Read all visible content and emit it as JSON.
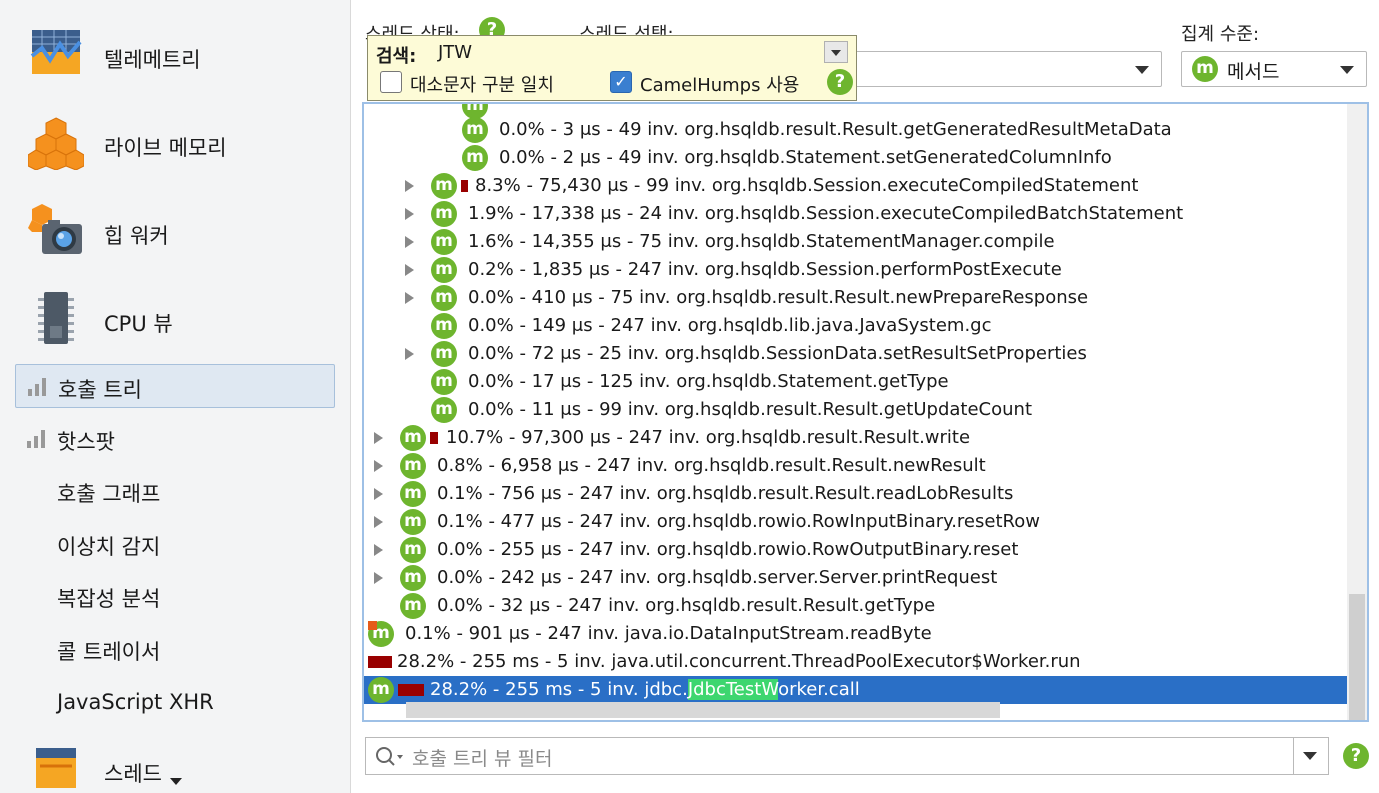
{
  "sidebar": {
    "big_items": [
      {
        "label": "텔레메트리",
        "icon": "telemetry-icon"
      },
      {
        "label": "라이브 메모리",
        "icon": "live-memory-icon"
      },
      {
        "label": "힙 워커",
        "icon": "heap-walker-icon"
      },
      {
        "label": "CPU 뷰",
        "icon": "cpu-chip-icon"
      }
    ],
    "small_items": [
      {
        "label": "호출 트리",
        "selected": true
      },
      {
        "label": "핫스팟"
      },
      {
        "label": "호출 그래프"
      },
      {
        "label": "이상치 감지"
      },
      {
        "label": "복잡성 분석"
      },
      {
        "label": "콜 트레이서"
      },
      {
        "label": "JavaScript XHR"
      }
    ],
    "bottom_item": {
      "label": "스레드",
      "icon": "threads-icon"
    }
  },
  "controls": {
    "thread_status_label": "스레드 상태:",
    "thread_select_label": "스레드 선택:",
    "aggregation_label": "집계 수준:",
    "aggregation_value": "메서드"
  },
  "search": {
    "label": "검색:",
    "value": "JTW",
    "case_sensitive_label": "대소문자 구분 일치",
    "case_sensitive_checked": false,
    "camelhumps_label": "CamelHumps 사용",
    "camelhumps_checked": true
  },
  "tree": {
    "rows": [
      {
        "text": "0.0% - 3 μs - 49 inv. org.hsqldb.result.Result.getGeneratedResultMetaData"
      },
      {
        "text": "0.0% - 2 μs - 49 inv. org.hsqldb.Statement.setGeneratedColumnInfo"
      },
      {
        "text": "8.3% - 75,430 μs - 99 inv. org.hsqldb.Session.executeCompiledStatement"
      },
      {
        "text": "1.9% - 17,338 μs - 24 inv. org.hsqldb.Session.executeCompiledBatchStatement"
      },
      {
        "text": "1.6% - 14,355 μs - 75 inv. org.hsqldb.StatementManager.compile"
      },
      {
        "text": "0.2% - 1,835 μs - 247 inv. org.hsqldb.Session.performPostExecute"
      },
      {
        "text": "0.0% - 410 μs - 75 inv. org.hsqldb.result.Result.newPrepareResponse"
      },
      {
        "text": "0.0% - 149 μs - 247 inv. org.hsqldb.lib.java.JavaSystem.gc"
      },
      {
        "text": "0.0% - 72 μs - 25 inv. org.hsqldb.SessionData.setResultSetProperties"
      },
      {
        "text": "0.0% - 17 μs - 125 inv. org.hsqldb.Statement.getType"
      },
      {
        "text": "0.0% - 11 μs - 99 inv. org.hsqldb.result.Result.getUpdateCount"
      },
      {
        "text": "10.7% - 97,300 μs - 247 inv. org.hsqldb.result.Result.write"
      },
      {
        "text": "0.8% - 6,958 μs - 247 inv. org.hsqldb.result.Result.newResult"
      },
      {
        "text": "0.1% - 756 μs - 247 inv. org.hsqldb.result.Result.readLobResults"
      },
      {
        "text": "0.1% - 477 μs - 247 inv. org.hsqldb.rowio.RowInputBinary.resetRow"
      },
      {
        "text": "0.0% - 255 μs - 247 inv. org.hsqldb.rowio.RowOutputBinary.reset"
      },
      {
        "text": "0.0% - 242 μs - 247 inv. org.hsqldb.server.Server.printRequest"
      },
      {
        "text": "0.0% - 32 μs - 247 inv. org.hsqldb.result.Result.getType"
      },
      {
        "text": "0.1% - 901 μs - 247 inv. java.io.DataInputStream.readByte"
      },
      {
        "text": "28.2% - 255 ms - 5 inv. java.util.concurrent.ThreadPoolExecutor$Worker.run"
      }
    ],
    "selected_row": {
      "prefix": "28.2% - 255 ms - 5 inv. jdbc.",
      "highlight": "JdbcTestW",
      "suffix": "orker.call"
    }
  },
  "filter": {
    "placeholder": "호출 트리 뷰 필터"
  },
  "icons": {
    "method": "m",
    "help": "?"
  },
  "colors": {
    "accent_green": "#6eb52e",
    "selection_blue": "#2a6fc6",
    "bar_red": "#990000",
    "search_highlight": "#3dd66f"
  }
}
